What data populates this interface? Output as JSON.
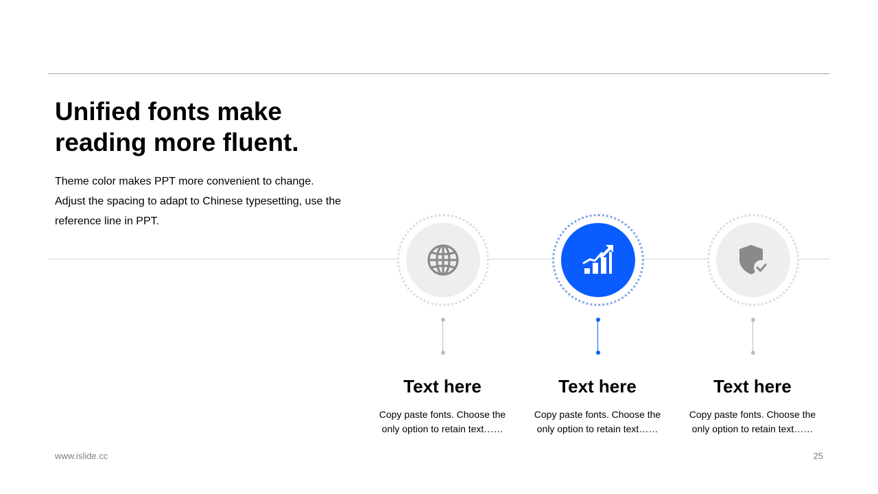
{
  "slide": {
    "title_lines": [
      "Unified fonts make",
      "reading more fluent."
    ],
    "body_lines": [
      "Theme color makes PPT more convenient to change.",
      "Adjust the spacing to adapt to Chinese typesetting, use the",
      "reference line in PPT."
    ]
  },
  "features": [
    {
      "icon": "globe-icon",
      "title": "Text here",
      "description": "Copy paste fonts. Choose the only option to retain text……",
      "active": false
    },
    {
      "icon": "growth-chart-icon",
      "title": "Text here",
      "description": "Copy paste fonts. Choose the only option to retain text……",
      "active": true
    },
    {
      "icon": "shield-check-icon",
      "title": "Text here",
      "description": "Copy paste fonts. Choose the only option to retain text……",
      "active": false
    }
  ],
  "footer": {
    "url": "www.islide.cc",
    "page_number": "25"
  },
  "colors": {
    "accent": "#0a5cff",
    "inactive_icon": "#8a8a8a",
    "inactive_disc": "#eeeeee",
    "text": "#000000",
    "muted": "#7f7f7f"
  }
}
